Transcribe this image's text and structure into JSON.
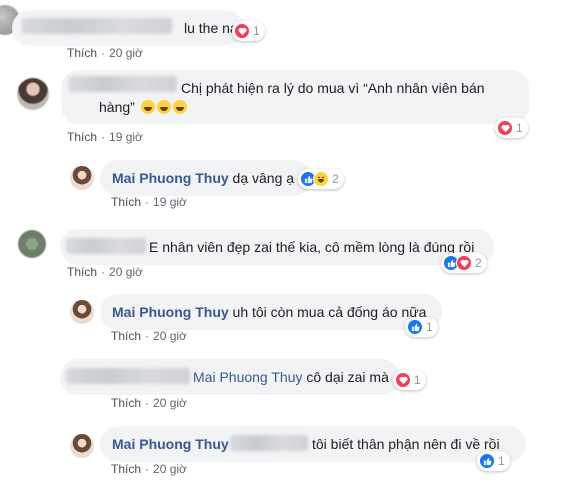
{
  "meta": {
    "like_label": "Thích"
  },
  "comments": [
    {
      "text": "lu the nat",
      "time": "20 giờ",
      "reactions": {
        "count": "1"
      }
    },
    {
      "text_line1": "Chị phát hiện ra lý do mua vì “Anh nhân viên bán",
      "text_line2": "hàng”",
      "time": "19 giờ",
      "reactions": {
        "count": "1"
      }
    },
    {
      "author": "Mai Phuong Thuy",
      "text": "dạ vâng ạ",
      "time": "19 giờ",
      "reactions": {
        "count": "2"
      }
    },
    {
      "text": "E nhân viên đẹp zai thế kia, cô mềm lòng là đúng rồi",
      "time": "20 giờ",
      "reactions": {
        "count": "2"
      }
    },
    {
      "author": "Mai Phuong Thuy",
      "text": "uh tôi còn mua cả đống áo nữa",
      "time": "20 giờ",
      "reactions": {
        "count": "1"
      }
    },
    {
      "tag": "Mai Phuong Thuy",
      "text": "cô dại zai mà",
      "time": "20 giờ",
      "reactions": {
        "count": "1"
      }
    },
    {
      "author": "Mai Phuong Thuy",
      "text": "tôi biết thân phận nên đi về rồi",
      "time": "20 giờ",
      "reactions": {
        "count": "1"
      }
    }
  ],
  "icons": {
    "heart": "heart-reaction-icon",
    "like": "like-reaction-icon",
    "haha": "haha-reaction-icon"
  },
  "colors": {
    "bubble": "#f2f3f5",
    "name": "#385898",
    "meta": "#606770",
    "heart": "#f33e58",
    "like": "#1877f2",
    "haha": "#fcd23d"
  }
}
